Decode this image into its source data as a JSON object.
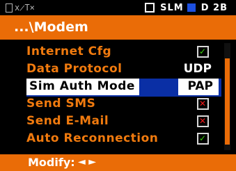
{
  "status": {
    "left_icons": "x̷T×",
    "mode": "SLM",
    "battery_label": "D 2B"
  },
  "title": "...\\Modem",
  "menu": [
    {
      "label": "Internet Cfg",
      "value_type": "check",
      "checked": true
    },
    {
      "label": "Data Protocol",
      "value_type": "text",
      "value": "UDP"
    },
    {
      "label": "Sim Auth Mode",
      "value_type": "text",
      "value": "PAP",
      "selected": true
    },
    {
      "label": "Send SMS",
      "value_type": "check",
      "checked": false
    },
    {
      "label": "Send E-Mail",
      "value_type": "check",
      "checked": false
    },
    {
      "label": "Auto Reconnection",
      "value_type": "check",
      "checked": true
    }
  ],
  "footer": {
    "label": "Modify:",
    "arrows": "◄ ►"
  },
  "colors": {
    "accent": "#ea6c07",
    "selection": "#0a2fa5",
    "check_on": "#39d40a",
    "check_off": "#f01818"
  }
}
